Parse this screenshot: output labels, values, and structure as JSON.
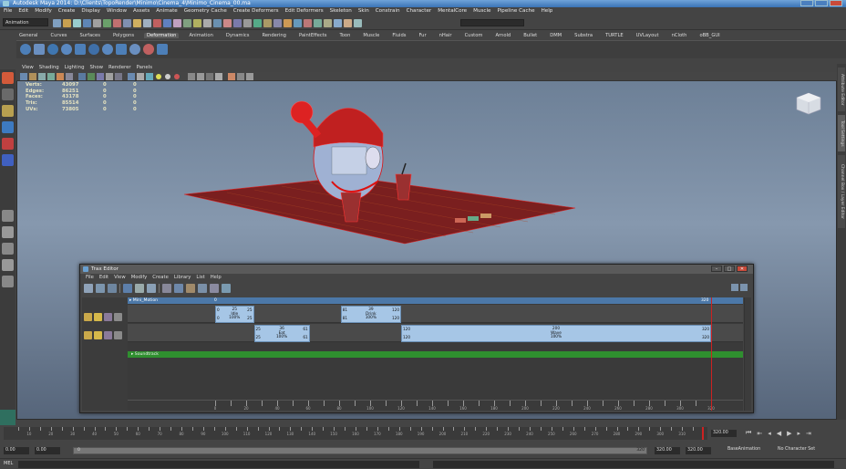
{
  "window": {
    "title": "Autodesk Maya 2014: D:\\Clients\\TopoRender\\Minimo\\Cinema_4\\Minimo_Cinema_00.ma"
  },
  "menubar": [
    "File",
    "Edit",
    "Modify",
    "Create",
    "Display",
    "Window",
    "Assets",
    "Animate",
    "Geometry Cache",
    "Create Deformers",
    "Edit Deformers",
    "Skeleton",
    "Skin",
    "Constrain",
    "Character",
    "MentalCore",
    "Muscle",
    "Pipeline Cache",
    "Help"
  ],
  "status_line": {
    "mode": "Animation"
  },
  "shelf_tabs": [
    {
      "label": "General",
      "active": false
    },
    {
      "label": "Curves",
      "active": false
    },
    {
      "label": "Surfaces",
      "active": false
    },
    {
      "label": "Polygons",
      "active": false
    },
    {
      "label": "Deformation",
      "active": true
    },
    {
      "label": "Animation",
      "active": false
    },
    {
      "label": "Dynamics",
      "active": false
    },
    {
      "label": "Rendering",
      "active": false
    },
    {
      "label": "PaintEffects",
      "active": false
    },
    {
      "label": "Toon",
      "active": false
    },
    {
      "label": "Muscle",
      "active": false
    },
    {
      "label": "Fluids",
      "active": false
    },
    {
      "label": "Fur",
      "active": false
    },
    {
      "label": "nHair",
      "active": false
    },
    {
      "label": "Custom",
      "active": false
    },
    {
      "label": "Arnold",
      "active": false
    },
    {
      "label": "Bullet",
      "active": false
    },
    {
      "label": "DMM",
      "active": false
    },
    {
      "label": "Substra",
      "active": false
    },
    {
      "label": "TURTLE",
      "active": false
    },
    {
      "label": "UVLayout",
      "active": false
    },
    {
      "label": "nCloth",
      "active": false
    },
    {
      "label": "oBB_GUI",
      "active": false
    }
  ],
  "panel_menu": [
    "View",
    "Shading",
    "Lighting",
    "Show",
    "Renderer",
    "Panels"
  ],
  "hud": [
    {
      "label": "Verts:",
      "v1": "43097",
      "v2": "0",
      "v3": "0"
    },
    {
      "label": "Edges:",
      "v1": "86251",
      "v2": "0",
      "v3": "0"
    },
    {
      "label": "Faces:",
      "v1": "43178",
      "v2": "0",
      "v3": "0"
    },
    {
      "label": "Tris:",
      "v1": "85514",
      "v2": "0",
      "v3": "0"
    },
    {
      "label": "UVs:",
      "v1": "73805",
      "v2": "0",
      "v3": "0"
    }
  ],
  "right_tabs": [
    "Attribute Editor",
    "Tool Settings",
    "Channel Box / Layer Editor"
  ],
  "trax": {
    "title": "Trax Editor",
    "menu": [
      "File",
      "Edit",
      "View",
      "Modify",
      "Create",
      "Library",
      "List",
      "Help"
    ],
    "character": "Mini_Motion",
    "char_start": "0",
    "char_end": "320",
    "soundtrack": "Soundtrack",
    "clips": [
      {
        "track": 0,
        "start": 0,
        "end": 25,
        "label": "25",
        "name": "Idle",
        "weight": "100%",
        "s": "0",
        "e": "25",
        "s2": "0",
        "e2": "25"
      },
      {
        "track": 0,
        "start": 81,
        "end": 120,
        "label": "39",
        "name": "Drink",
        "weight": "100%",
        "s": "81",
        "e": "120",
        "s2": "81",
        "e2": "120"
      },
      {
        "track": 1,
        "start": 25,
        "end": 61,
        "label": "36",
        "name": "Eat",
        "weight": "100%",
        "s": "25",
        "e": "61",
        "s2": "25",
        "e2": "61"
      },
      {
        "track": 1,
        "start": 120,
        "end": 320,
        "label": "200",
        "name": "Wave",
        "weight": "100%",
        "s": "120",
        "e": "320",
        "s2": "120",
        "e2": "320"
      }
    ],
    "ruler_ticks": [
      "0",
      "10",
      "20",
      "30",
      "40",
      "50",
      "60",
      "70",
      "80",
      "90",
      "100",
      "110",
      "120",
      "130",
      "140",
      "150",
      "160",
      "170",
      "180",
      "190",
      "200",
      "210",
      "220",
      "230",
      "240",
      "250",
      "260",
      "270",
      "280",
      "290",
      "300",
      "310",
      "320"
    ],
    "current_frame": 320
  },
  "time_slider": {
    "current": "320.00",
    "ticks": [
      "5",
      "10",
      "15",
      "20",
      "25",
      "30",
      "35",
      "40",
      "45",
      "50",
      "55",
      "60",
      "65",
      "70",
      "75",
      "80",
      "85",
      "90",
      "95",
      "100",
      "105",
      "110",
      "115",
      "120",
      "125",
      "130",
      "135",
      "140",
      "145",
      "150",
      "155",
      "160",
      "165",
      "170",
      "175",
      "180",
      "185",
      "190",
      "195",
      "200",
      "205",
      "210",
      "215",
      "220",
      "225",
      "230",
      "235",
      "240",
      "245",
      "250",
      "255",
      "260",
      "265",
      "270",
      "275",
      "280",
      "285",
      "290",
      "295",
      "300",
      "305",
      "310",
      "315"
    ]
  },
  "range": {
    "start": "0.00",
    "playback_start": "0.00",
    "bar_start": "0",
    "bar_end": "320",
    "playback_end": "320.00",
    "end": "320.00",
    "anim_layer": "BaseAnimation",
    "char_set": "No Character Set"
  },
  "cmdline": {
    "label": "MEL"
  },
  "colors": {
    "clip": "#a6c6e6",
    "character_row": "#4c78a8",
    "soundtrack": "#2f8f2f",
    "time_marker": "#cc2222"
  }
}
